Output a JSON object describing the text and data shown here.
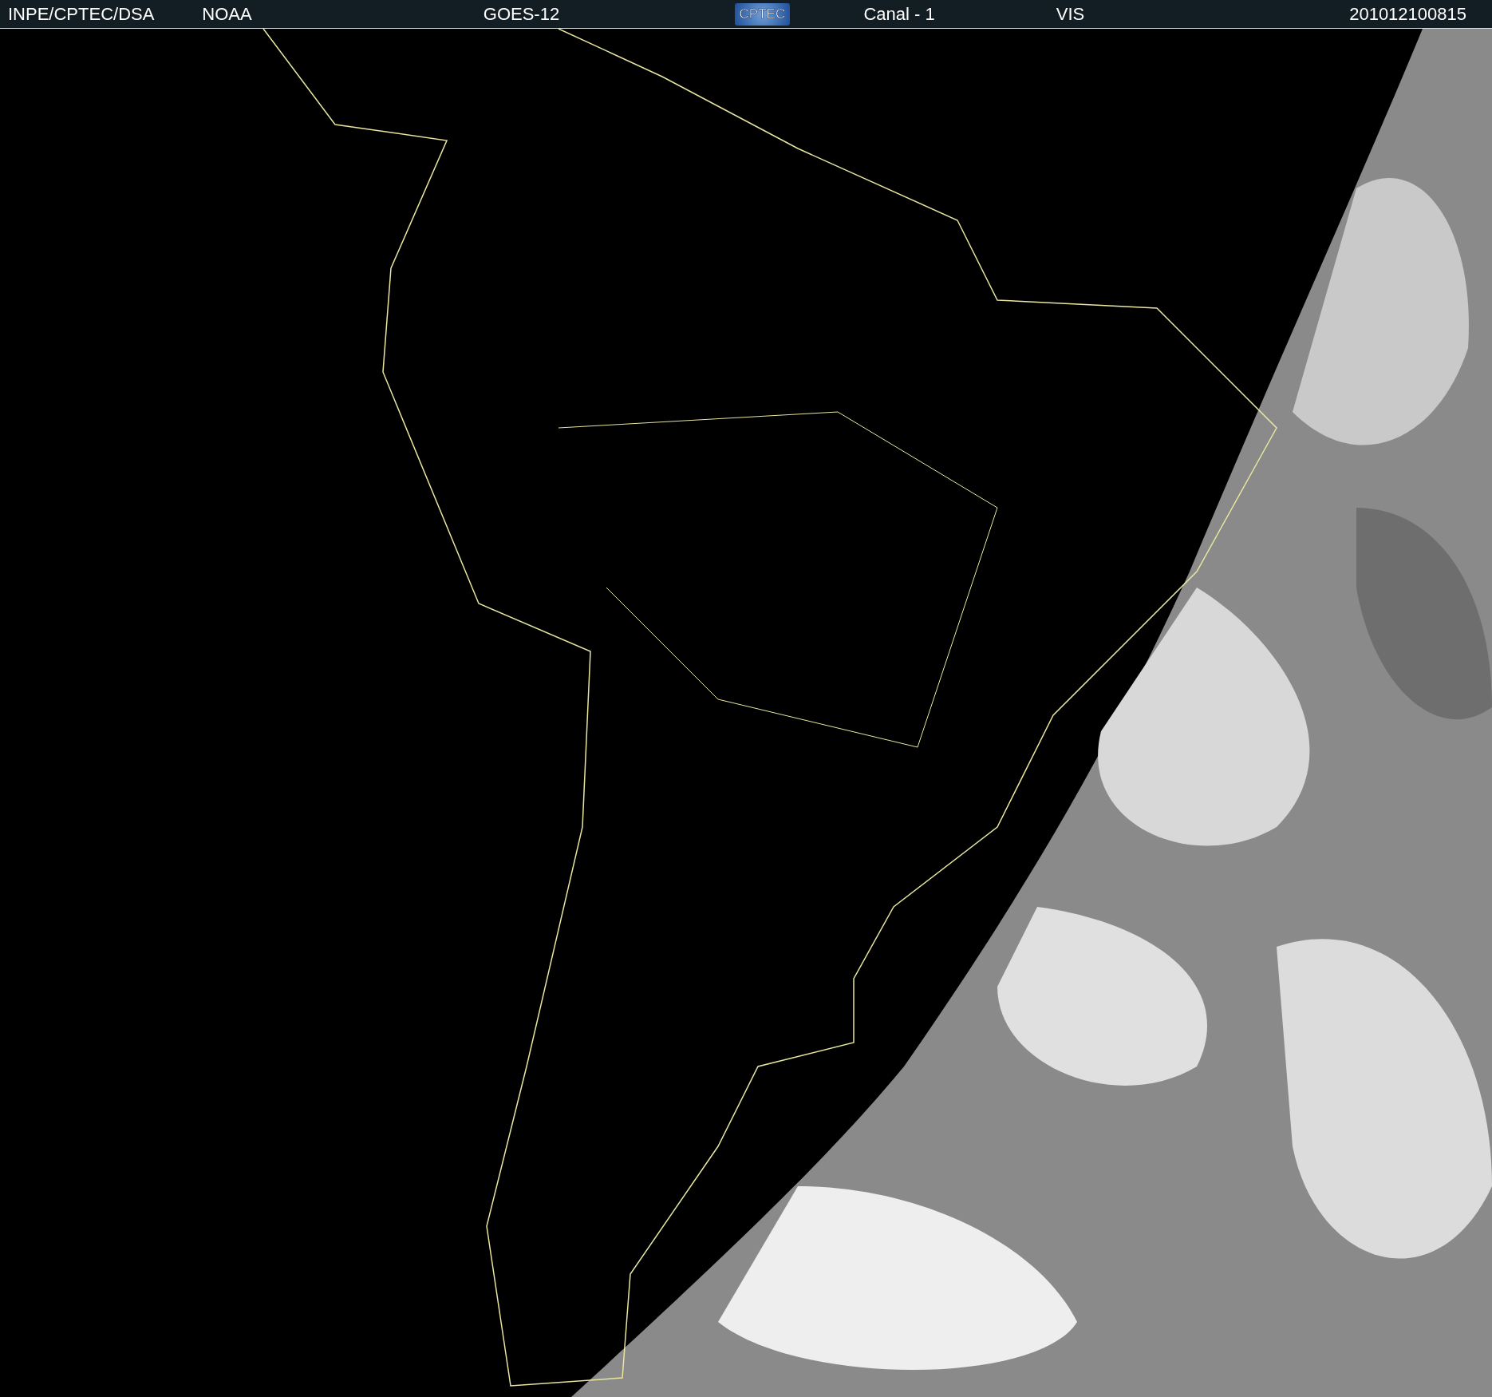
{
  "header": {
    "items": [
      {
        "kind": "text",
        "text": "INPE/CPTEC/DSA"
      },
      {
        "kind": "text",
        "text": "NOAA"
      },
      {
        "kind": "text",
        "text": "GOES-12"
      },
      {
        "kind": "logo",
        "text": "CPTEC"
      },
      {
        "kind": "text",
        "text": "Canal - 1"
      },
      {
        "kind": "text",
        "text": "VIS"
      },
      {
        "kind": "text",
        "text": "201012100815"
      }
    ]
  }
}
